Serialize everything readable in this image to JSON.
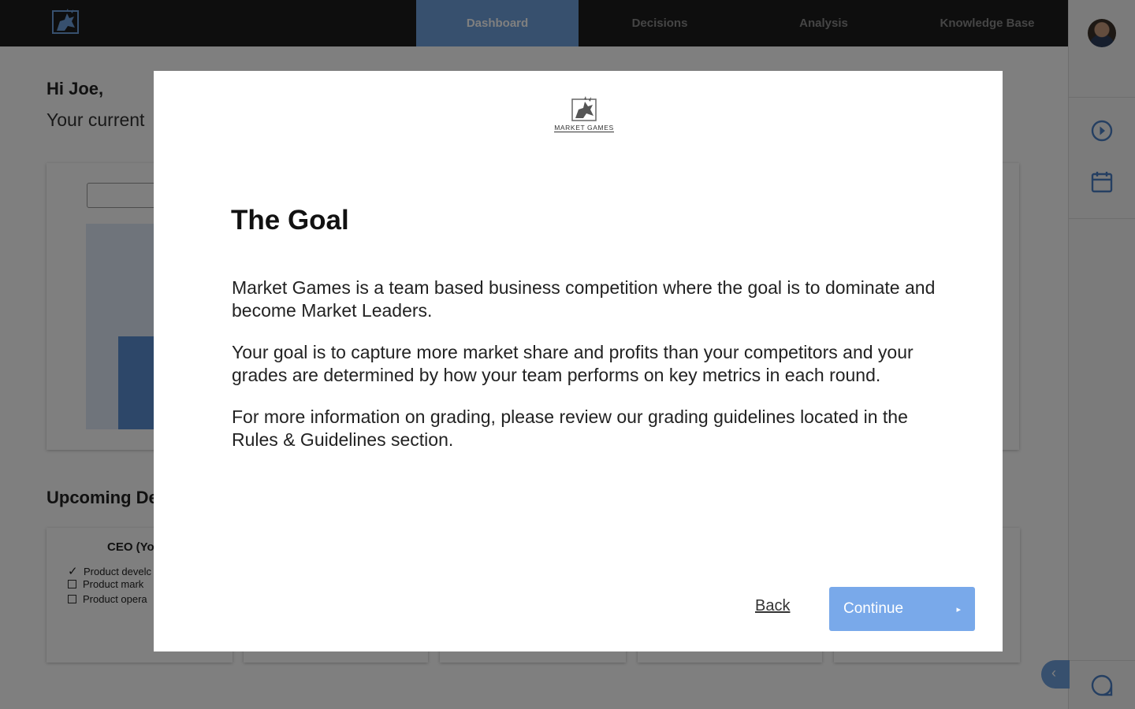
{
  "header": {
    "tabs": [
      {
        "label": "Dashboard",
        "active": true
      },
      {
        "label": "Decisions",
        "active": false
      },
      {
        "label": "Analysis",
        "active": false
      },
      {
        "label": "Knowledge Base",
        "active": false
      }
    ]
  },
  "rail": {
    "icons": [
      "avatar",
      "clock-icon",
      "calendar-icon",
      "chat-icon"
    ]
  },
  "dashboard": {
    "greeting": "Hi Joe,",
    "subtitle": "Your current",
    "upcoming_title": "Upcoming De",
    "ceo_card": {
      "title": "CEO (Yo",
      "tasks": [
        {
          "label": "Product develc",
          "checked": true
        },
        {
          "label": "Product mark",
          "checked": false
        },
        {
          "label": "Product opera",
          "checked": false
        }
      ]
    }
  },
  "modal": {
    "brand_name": "MARKET GAMES",
    "title": "The Goal",
    "paragraphs": [
      "Market Games is a team based business competition where the goal is to dominate and become Market Leaders.",
      "Your goal is to capture more market share and profits than your competitors and your grades are determined by how your team performs on key metrics in each round.",
      "For more information on grading, please review our grading guidelines located in the Rules & Guidelines section."
    ],
    "back_label": "Back",
    "continue_label": "Continue",
    "continue_arrow": "▸"
  },
  "colors": {
    "accent": "#6fa0dd",
    "button": "#79a9ea",
    "topbar": "#1c1c1c"
  }
}
